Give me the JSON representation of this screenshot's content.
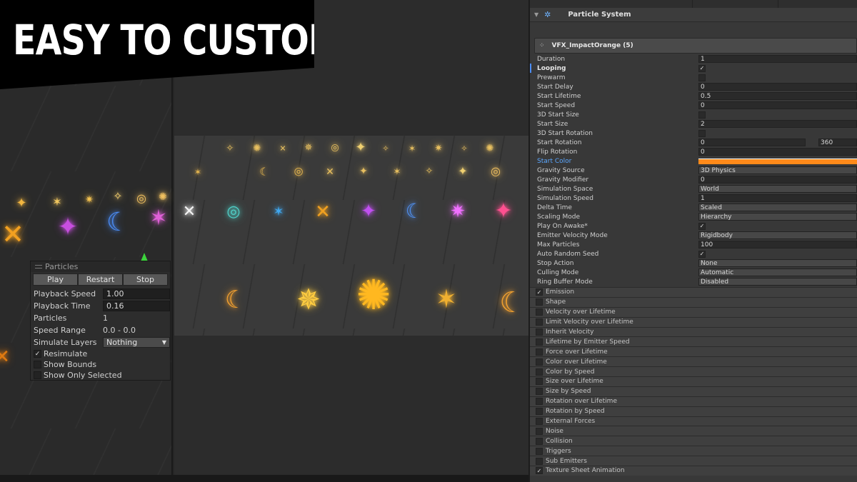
{
  "banner": {
    "title": "EASY TO CUSTOM"
  },
  "particles_overlay": {
    "title": "Particles",
    "buttons": {
      "play": "Play",
      "restart": "Restart",
      "stop": "Stop"
    },
    "playback_speed": {
      "label": "Playback Speed",
      "value": "1.00"
    },
    "playback_time": {
      "label": "Playback Time",
      "value": "0.16"
    },
    "particles": {
      "label": "Particles",
      "value": "1"
    },
    "speed_range": {
      "label": "Speed Range",
      "value": "0.0 - 0.0"
    },
    "simulate_layers": {
      "label": "Simulate Layers",
      "value": "Nothing"
    },
    "resimulate": {
      "label": "Resimulate",
      "checked": true
    },
    "show_bounds": {
      "label": "Show Bounds",
      "checked": false
    },
    "show_only_selected": {
      "label": "Show Only Selected",
      "checked": false
    }
  },
  "inspector": {
    "component_title": "Particle System",
    "object_name": "VFX_ImpactOrange (5)",
    "properties": {
      "duration": {
        "label": "Duration",
        "value": "1"
      },
      "looping": {
        "label": "Looping",
        "checked": true
      },
      "prewarm": {
        "label": "Prewarm",
        "checked": false
      },
      "start_delay": {
        "label": "Start Delay",
        "value": "0"
      },
      "start_lifetime": {
        "label": "Start Lifetime",
        "value": "0.5"
      },
      "start_speed": {
        "label": "Start Speed",
        "value": "0"
      },
      "start_size_3d": {
        "label": "3D Start Size",
        "checked": false
      },
      "start_size": {
        "label": "Start Size",
        "value": "2"
      },
      "start_rotation_3d": {
        "label": "3D Start Rotation",
        "checked": false
      },
      "start_rotation": {
        "label": "Start Rotation",
        "value_min": "0",
        "value_max": "360"
      },
      "flip_rotation": {
        "label": "Flip Rotation",
        "value": "0"
      },
      "start_color": {
        "label": "Start Color",
        "color": "#ff8a1a"
      },
      "gravity_source": {
        "label": "Gravity Source",
        "value": "3D Physics"
      },
      "gravity_modifier": {
        "label": "Gravity Modifier",
        "value": "0"
      },
      "simulation_space": {
        "label": "Simulation Space",
        "value": "World"
      },
      "simulation_speed": {
        "label": "Simulation Speed",
        "value": "1"
      },
      "delta_time": {
        "label": "Delta Time",
        "value": "Scaled"
      },
      "scaling_mode": {
        "label": "Scaling Mode",
        "value": "Hierarchy"
      },
      "play_on_awake": {
        "label": "Play On Awake*",
        "checked": true
      },
      "emitter_velocity_mode": {
        "label": "Emitter Velocity Mode",
        "value": "Rigidbody"
      },
      "max_particles": {
        "label": "Max Particles",
        "value": "100"
      },
      "auto_random_seed": {
        "label": "Auto Random Seed",
        "checked": true
      },
      "stop_action": {
        "label": "Stop Action",
        "value": "None"
      },
      "culling_mode": {
        "label": "Culling Mode",
        "value": "Automatic"
      },
      "ring_buffer_mode": {
        "label": "Ring Buffer Mode",
        "value": "Disabled"
      }
    },
    "modules": [
      {
        "label": "Emission",
        "checked": true
      },
      {
        "label": "Shape",
        "checked": false
      },
      {
        "label": "Velocity over Lifetime",
        "checked": false
      },
      {
        "label": "Limit Velocity over Lifetime",
        "checked": false
      },
      {
        "label": "Inherit Velocity",
        "checked": false
      },
      {
        "label": "Lifetime by Emitter Speed",
        "checked": false
      },
      {
        "label": "Force over Lifetime",
        "checked": false
      },
      {
        "label": "Color over Lifetime",
        "checked": false
      },
      {
        "label": "Color by Speed",
        "checked": false
      },
      {
        "label": "Size over Lifetime",
        "checked": false
      },
      {
        "label": "Size by Speed",
        "checked": false
      },
      {
        "label": "Rotation over Lifetime",
        "checked": false
      },
      {
        "label": "Rotation by Speed",
        "checked": false
      },
      {
        "label": "External Forces",
        "checked": false
      },
      {
        "label": "Noise",
        "checked": false
      },
      {
        "label": "Collision",
        "checked": false
      },
      {
        "label": "Triggers",
        "checked": false
      },
      {
        "label": "Sub Emitters",
        "checked": false
      },
      {
        "label": "Texture Sheet Animation",
        "checked": true
      }
    ]
  },
  "colors": {
    "accent_orange": "#ff8a1a",
    "accent_blue": "#4c8df6",
    "gizmo_green": "#3cd33c"
  },
  "check_glyph": "✓"
}
